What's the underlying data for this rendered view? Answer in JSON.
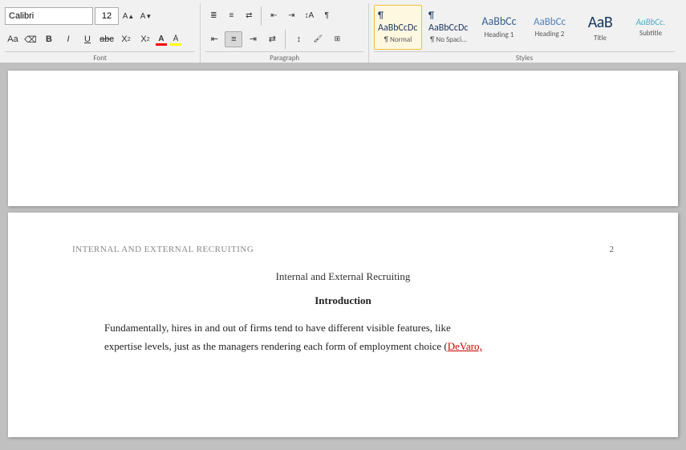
{
  "toolbar": {
    "font_size": "12",
    "font_name": "Calibri",
    "groups": {
      "font_label": "Font",
      "paragraph_label": "Paragraph",
      "styles_label": "Styles"
    },
    "expand_icon": "⌄"
  },
  "styles": [
    {
      "id": "normal",
      "preview": "¶ AaBbCcDc",
      "label": "¶ Normal",
      "active": true
    },
    {
      "id": "nospace",
      "preview": "¶ AaBbCcDc",
      "label": "¶ No Spaci...",
      "active": false
    },
    {
      "id": "h1",
      "preview": "AaBbCc",
      "label": "Heading 1",
      "active": false
    },
    {
      "id": "h2",
      "preview": "AaBbCc",
      "label": "Heading 2",
      "active": false
    },
    {
      "id": "title",
      "preview": "AaB",
      "label": "Title",
      "active": false
    },
    {
      "id": "subtitle",
      "preview": "AaBbCc.",
      "label": "Subtitle",
      "active": false
    }
  ],
  "document": {
    "page2": {
      "header": "INTERNAL AND EXTERNAL RECRUITING",
      "page_number": "2",
      "title": "Internal and External Recruiting",
      "section": "Introduction",
      "paragraph1": "Fundamentally, hires in and out of firms tend to have different visible features, like",
      "paragraph2": "expertise levels, just as the managers rendering each form of employment choice (DeVaro,"
    }
  }
}
